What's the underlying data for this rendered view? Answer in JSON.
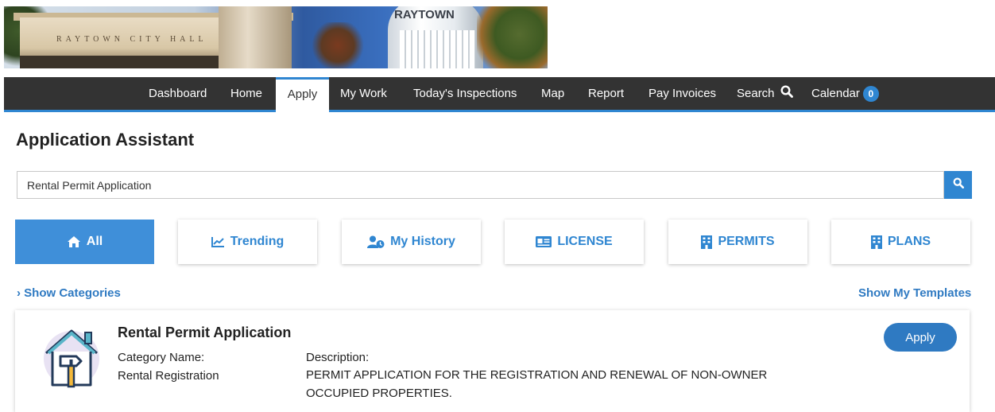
{
  "banner": {
    "hall_text": "RAYTOWN CITY HALL",
    "tower_text": "RAYTOWN"
  },
  "nav": {
    "items": [
      {
        "label": "Dashboard"
      },
      {
        "label": "Home"
      },
      {
        "label": "Apply",
        "active": true
      },
      {
        "label": "My Work"
      },
      {
        "label": "Today's Inspections"
      },
      {
        "label": "Map"
      },
      {
        "label": "Report"
      },
      {
        "label": "Pay Invoices"
      },
      {
        "label": "Search",
        "icon": "search-icon"
      },
      {
        "label": "Calendar",
        "badge": "0"
      }
    ],
    "accent_color": "#2f86d1"
  },
  "page": {
    "title": "Application Assistant"
  },
  "search": {
    "value": "Rental Permit Application",
    "button_icon": "search-icon"
  },
  "filters": [
    {
      "label": "All",
      "icon": "home-icon",
      "active": true
    },
    {
      "label": "Trending",
      "icon": "trending-chart-icon"
    },
    {
      "label": "My History",
      "icon": "user-history-icon"
    },
    {
      "label": "LICENSE",
      "icon": "id-card-icon"
    },
    {
      "label": "PERMITS",
      "icon": "building-icon"
    },
    {
      "label": "PLANS",
      "icon": "building-icon"
    }
  ],
  "links": {
    "show_categories": "Show Categories",
    "show_templates": "Show My Templates"
  },
  "result": {
    "title": "Rental Permit Application",
    "category_label": "Category Name:",
    "category_value": "Rental Registration",
    "description_label": "Description:",
    "description_value": "PERMIT APPLICATION FOR THE REGISTRATION AND RENEWAL OF NON-OWNER OCCUPIED PROPERTIES.",
    "apply_label": "Apply",
    "icon": "house-hammer-icon"
  }
}
